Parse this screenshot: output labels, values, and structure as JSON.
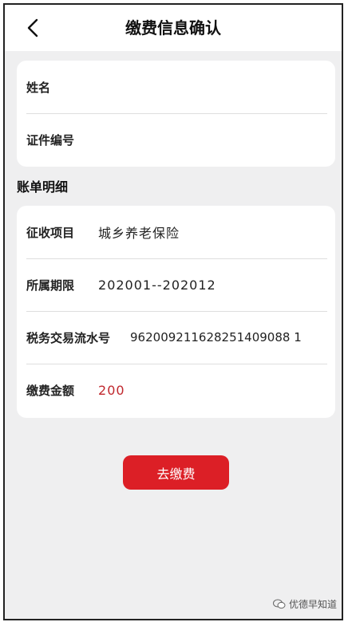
{
  "header": {
    "title": "缴费信息确认"
  },
  "identity": {
    "name_label": "姓名",
    "id_label": "证件编号"
  },
  "section_title": "账单明细",
  "details": [
    {
      "label": "征收项目",
      "value": "城乡养老保险"
    },
    {
      "label": "所属期限",
      "value": "202001--202012"
    },
    {
      "label": "税务交易流水号",
      "value": "962009211628251409088 1"
    },
    {
      "label": "缴费金额",
      "value": "200"
    }
  ],
  "actions": {
    "pay_label": "去缴费"
  },
  "watermark": {
    "text": "优德早知道"
  },
  "colors": {
    "accent": "#dc1f26",
    "amount": "#c0272d",
    "background": "#efeff0"
  }
}
